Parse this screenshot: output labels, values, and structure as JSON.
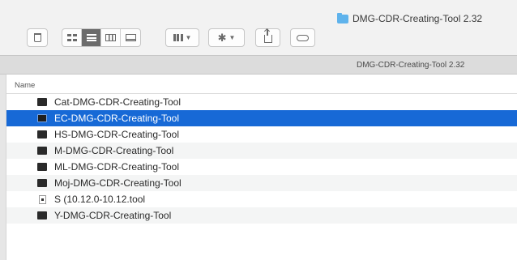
{
  "window": {
    "title": "DMG-CDR-Creating-Tool 2.32",
    "tab_title": "DMG-CDR-Creating-Tool 2.32"
  },
  "toolbar": {
    "delete_icon": "trash-icon",
    "view_modes": [
      "icon-view",
      "list-view",
      "column-view",
      "gallery-view"
    ],
    "active_view": "list-view",
    "arrange_icon": "arrange-icon",
    "action_icon": "gear-icon",
    "share_icon": "share-icon",
    "tag_icon": "tag-icon"
  },
  "list": {
    "column_header": "Name",
    "items": [
      {
        "name": "Cat-DMG-CDR-Creating-Tool",
        "icon": "executable-icon"
      },
      {
        "name": "EC-DMG-CDR-Creating-Tool",
        "icon": "executable-icon",
        "selected": true
      },
      {
        "name": "HS-DMG-CDR-Creating-Tool",
        "icon": "executable-icon"
      },
      {
        "name": "M-DMG-CDR-Creating-Tool",
        "icon": "executable-icon"
      },
      {
        "name": "ML-DMG-CDR-Creating-Tool",
        "icon": "executable-icon"
      },
      {
        "name": "Moj-DMG-CDR-Creating-Tool",
        "icon": "executable-icon"
      },
      {
        "name": "S (10.12.0-10.12.tool",
        "icon": "document-icon"
      },
      {
        "name": "Y-DMG-CDR-Creating-Tool",
        "icon": "executable-icon"
      }
    ]
  },
  "colors": {
    "selection": "#1769d6",
    "folder": "#5fb3ec",
    "toolbar_bg": "#f2f2f2",
    "tab_bar_bg": "#dcdcdc"
  }
}
